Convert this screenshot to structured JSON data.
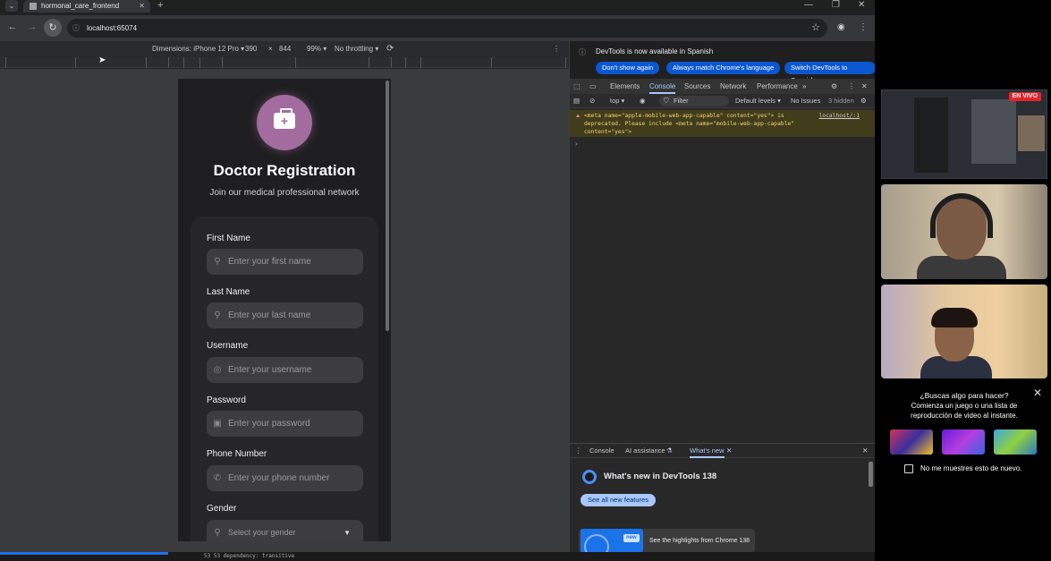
{
  "browser": {
    "tab_title": "hormonal_care_frontend",
    "tab_close": "✕",
    "new_tab": "+",
    "url": "localhost:65074"
  },
  "device_toolbar": {
    "dimensions_label": "Dimensions: iPhone 12 Pro ▾",
    "width": "390",
    "times": "×",
    "height": "844",
    "zoom": "99% ▾",
    "throttling": "No throttling ▾"
  },
  "app": {
    "title": "Doctor Registration",
    "subtitle": "Join our medical professional network",
    "fields": [
      {
        "label": "First Name",
        "placeholder": "Enter your first name",
        "icon": "person-icon"
      },
      {
        "label": "Last Name",
        "placeholder": "Enter your last name",
        "icon": "person-icon"
      },
      {
        "label": "Username",
        "placeholder": "Enter your username",
        "icon": "account-circle-icon"
      },
      {
        "label": "Password",
        "placeholder": "Enter your password",
        "icon": "lock-icon"
      },
      {
        "label": "Phone Number",
        "placeholder": "Enter your phone number",
        "icon": "phone-icon"
      },
      {
        "label": "Gender",
        "placeholder": "Select your gender",
        "icon": "person-icon"
      }
    ]
  },
  "devtools": {
    "notice": "DevTools is now available in Spanish",
    "btn_dont_show": "Don't show again",
    "btn_match": "Always match Chrome's language",
    "btn_switch": "Switch DevTools to Spanish",
    "tabs": [
      "Elements",
      "Console",
      "Sources",
      "Network",
      "Performance"
    ],
    "active_tab": "Console",
    "context": "top ▾",
    "filter_placeholder": "Filter",
    "levels": "Default levels ▾",
    "issues": "No Issues",
    "hidden": "3 hidden",
    "warning_line1": "<meta name=\"apple-mobile-web-app-capable\" content=\"yes\"> is",
    "warning_line2": "deprecated. Please include <meta name=\"mobile-web-app-capable\"",
    "warning_line3": "content=\"yes\">",
    "warning_source": "localhost/:1",
    "prompt": "›",
    "drawer_tabs": [
      "Console",
      "AI assistance",
      "What's new"
    ],
    "whatsnew_title": "What's new in DevTools 138",
    "see_all": "See all new features",
    "new_badge": "new",
    "highlights": "See the highlights from Chrome 138"
  },
  "statusbar": {
    "text": "53    53         dependency: transitive"
  },
  "side": {
    "live_badge": "EN VIVO",
    "promo_title": "¿Buscas algo para hacer?",
    "promo_body_1": "Comienza un juego o una lista de",
    "promo_body_2": "reproducción de video al instante.",
    "promo_close": "✕",
    "dont_show": "No me muestres esto de nuevo."
  },
  "colors": {
    "accent": "#a26c9f",
    "devtools_blue": "#0b57d0",
    "live_red": "#e5232a"
  }
}
